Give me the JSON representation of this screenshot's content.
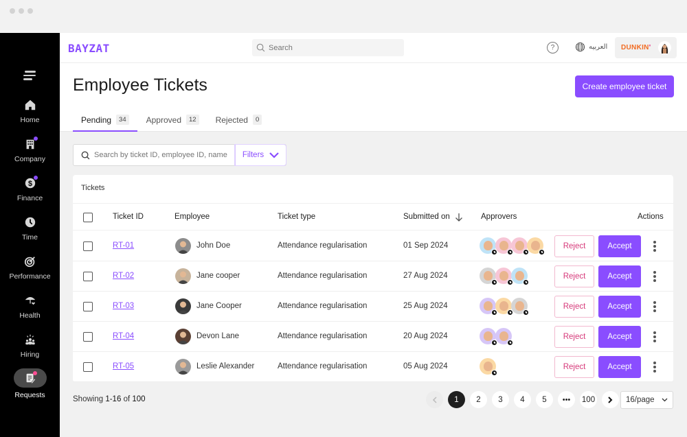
{
  "app": {
    "logo": "BAYZAT"
  },
  "topbar": {
    "search_placeholder": "Search",
    "help_icon": "help-circle-icon",
    "language_label": "العربيه",
    "company_name": "DUNKIN",
    "company_apostrophe": "'"
  },
  "sidebar": {
    "items": [
      {
        "label": "Home",
        "icon": "home-icon",
        "dot": false
      },
      {
        "label": "Company",
        "icon": "building-icon",
        "dot": true
      },
      {
        "label": "Finance",
        "icon": "dollar-coin-icon",
        "dot": true
      },
      {
        "label": "Time",
        "icon": "clock-icon",
        "dot": false
      },
      {
        "label": "Performance",
        "icon": "target-icon",
        "dot": false
      },
      {
        "label": "Health",
        "icon": "umbrella-heart-icon",
        "dot": false
      },
      {
        "label": "Hiring",
        "icon": "people-icon",
        "dot": false
      },
      {
        "label": "Requests",
        "icon": "clipboard-edit-icon",
        "dot": true,
        "active": true
      }
    ]
  },
  "page": {
    "title": "Employee Tickets",
    "create_button": "Create employee ticket",
    "tabs": [
      {
        "label": "Pending",
        "count": "34",
        "active": true
      },
      {
        "label": "Approved",
        "count": "12",
        "active": false
      },
      {
        "label": "Rejected",
        "count": "0",
        "active": false
      }
    ],
    "filter_search_placeholder": "Search by ticket ID, employee ID, name",
    "filters_label": "Filters"
  },
  "table": {
    "title": "Tickets",
    "columns": [
      "Ticket ID",
      "Employee",
      "Ticket type",
      "Submitted on",
      "Approvers",
      "Actions"
    ],
    "sort_column": "Submitted on",
    "sort_direction": "descending",
    "reject_label": "Reject",
    "accept_label": "Accept",
    "rows": [
      {
        "id": "RT-01",
        "employee": "John Doe",
        "type": "Attendance regularisation",
        "submitted": "01 Sep 2024",
        "approvers": 4,
        "approver_colors": [
          "#bfe3f7",
          "#f7c6d6",
          "#f7c6d6",
          "#fbd9a4"
        ],
        "avatar_color": "#8c8c8c"
      },
      {
        "id": "RT-02",
        "employee": "Jane cooper",
        "type": "Attendance regularisation",
        "submitted": "27 Aug 2024",
        "approvers": 3,
        "approver_colors": [
          "#d5d5d5",
          "#f7c6d6",
          "#bfe3f7"
        ],
        "avatar_color": "#c7b39b"
      },
      {
        "id": "RT-03",
        "employee": "Jane Cooper",
        "type": "Attendance regularisation",
        "submitted": "25 Aug 2024",
        "approvers": 3,
        "approver_colors": [
          "#d6c6f7",
          "#fbd9a4",
          "#d5d5d5"
        ],
        "avatar_color": "#3a3a3a"
      },
      {
        "id": "RT-04",
        "employee": "Devon Lane",
        "type": "Attendance regularisation",
        "submitted": "20 Aug 2024",
        "approvers": 2,
        "approver_colors": [
          "#d6c6f7",
          "#d6c6f7"
        ],
        "avatar_color": "#5a4034"
      },
      {
        "id": "RT-05",
        "employee": "Leslie Alexander",
        "type": "Attendance regularisation",
        "submitted": "05 Aug 2024",
        "approvers": 1,
        "approver_colors": [
          "#fbd9a4"
        ],
        "avatar_color": "#9a9a9a"
      }
    ]
  },
  "pagination": {
    "showing_prefix": "Showing",
    "showing_range": "1-16",
    "showing_of": "of",
    "showing_total": "100",
    "pages": [
      "1",
      "2",
      "3",
      "4",
      "5",
      "•••",
      "100"
    ],
    "current_page": "1",
    "per_page": "16/page"
  }
}
